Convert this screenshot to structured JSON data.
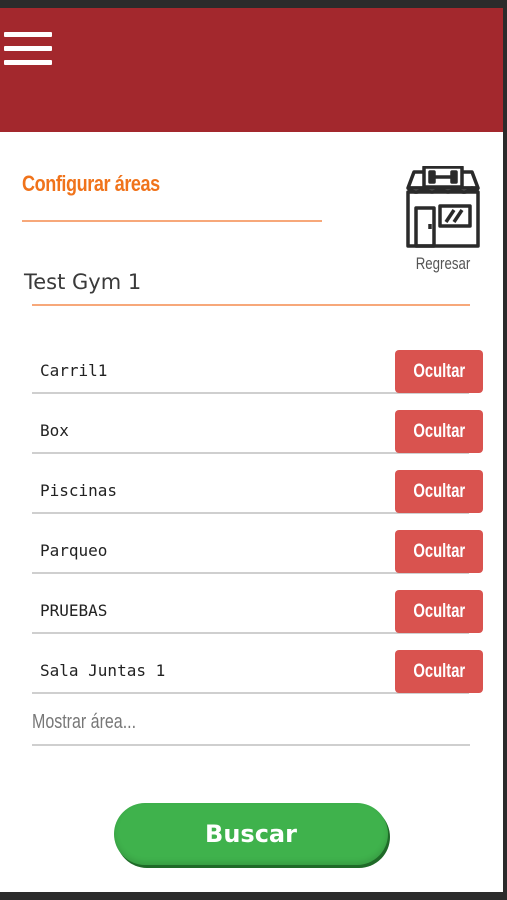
{
  "header": {
    "menu_icon": "hamburger-menu-icon",
    "color": "#a3282d"
  },
  "section": {
    "title": "Configurar áreas"
  },
  "back": {
    "label": "Regresar",
    "icon": "gym-storefront-icon"
  },
  "gym": {
    "name": "Test Gym 1"
  },
  "areas": [
    {
      "name": "Carril1",
      "action": "Ocultar"
    },
    {
      "name": "Box",
      "action": "Ocultar"
    },
    {
      "name": "Piscinas",
      "action": "Ocultar"
    },
    {
      "name": "Parqueo",
      "action": "Ocultar"
    },
    {
      "name": "PRUEBAS",
      "action": "Ocultar"
    },
    {
      "name": "Sala Juntas 1",
      "action": "Ocultar"
    }
  ],
  "show_area": {
    "placeholder": "Mostrar área..."
  },
  "search": {
    "label": "Buscar"
  },
  "colors": {
    "accent": "#f0731b",
    "hide_button": "#d9534f",
    "search_button": "#3fb24c"
  }
}
